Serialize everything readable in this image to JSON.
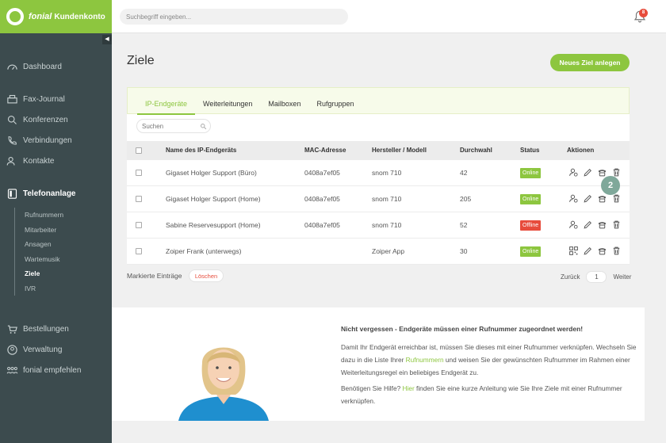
{
  "brand": {
    "name": "fonial",
    "suffix": "Kundenkonto"
  },
  "search": {
    "placeholder": "Suchbegriff eingeben..."
  },
  "notifications": {
    "count": "8"
  },
  "sidebar": {
    "items": [
      {
        "label": "Dashboard",
        "icon": "gauge-icon"
      },
      {
        "label": "Fax-Journal",
        "icon": "fax-icon"
      },
      {
        "label": "Konferenzen",
        "icon": "conference-icon"
      },
      {
        "label": "Verbindungen",
        "icon": "phone-icon"
      },
      {
        "label": "Kontakte",
        "icon": "contacts-icon"
      },
      {
        "label": "Telefonanlage",
        "icon": "phone-system-icon"
      },
      {
        "label": "Bestellungen",
        "icon": "cart-icon"
      },
      {
        "label": "Verwaltung",
        "icon": "user-circle-icon"
      },
      {
        "label": "fonial empfehlen",
        "icon": "recommend-icon"
      }
    ],
    "sub_items": [
      "Rufnummern",
      "Mitarbeiter",
      "Ansagen",
      "Wartemusik",
      "Ziele",
      "IVR"
    ]
  },
  "page": {
    "title": "Ziele",
    "new_button": "Neues Ziel anlegen"
  },
  "tabs": [
    "IP-Endgeräte",
    "Weiterleitungen",
    "Mailboxen",
    "Rufgruppen"
  ],
  "table": {
    "search_placeholder": "Suchen",
    "headers": {
      "name": "Name des IP-Endgeräts",
      "mac": "MAC-Adresse",
      "vendor": "Hersteller / Modell",
      "ext": "Durchwahl",
      "status": "Status",
      "actions": "Aktionen"
    },
    "rows": [
      {
        "name": "Gigaset Holger Support (Büro)",
        "mac": "0408a7ef05",
        "vendor": "snom 710",
        "ext": "42",
        "status": "Online",
        "online": true
      },
      {
        "name": "Gigaset Holger Support (Home)",
        "mac": "0408a7ef05",
        "vendor": "snom 710",
        "ext": "205",
        "status": "Online",
        "online": true
      },
      {
        "name": "Sabine Reservesupport (Home)",
        "mac": "0408a7ef05",
        "vendor": "snom 710",
        "ext": "52",
        "status": "Offline",
        "online": false
      },
      {
        "name": "Zoiper Frank (unterwegs)",
        "mac": "",
        "vendor": "Zoiper App",
        "ext": "30",
        "status": "Online",
        "online": true
      }
    ]
  },
  "footer": {
    "marked": "Markierte Einträge",
    "delete": "Löschen",
    "back": "Zurück",
    "page": "1",
    "next": "Weiter"
  },
  "bubble": "2",
  "info": {
    "title": "Nicht vergessen - Endgeräte müssen einer Rufnummer zugeordnet werden!",
    "p1_a": "Damit Ihr Endgerät erreichbar ist, müssen Sie dieses mit einer Rufnummer verknüpfen. Wechseln Sie dazu in die Liste Ihrer ",
    "p1_link": "Rufnummern",
    "p1_b": " und weisen Sie der gewünschten Rufnummer im Rahmen einer Weiterleitungsregel ein beliebiges Endgerät zu.",
    "p2_a": "Benötigen Sie Hilfe? ",
    "p2_link": "Hier",
    "p2_b": " finden Sie eine kurze Anleitung wie Sie Ihre Ziele mit einer Rufnummer verknüpfen."
  },
  "colors": {
    "accent": "#8dc63f",
    "sidebar": "#3c4b4e",
    "offline": "#e74c3c"
  }
}
